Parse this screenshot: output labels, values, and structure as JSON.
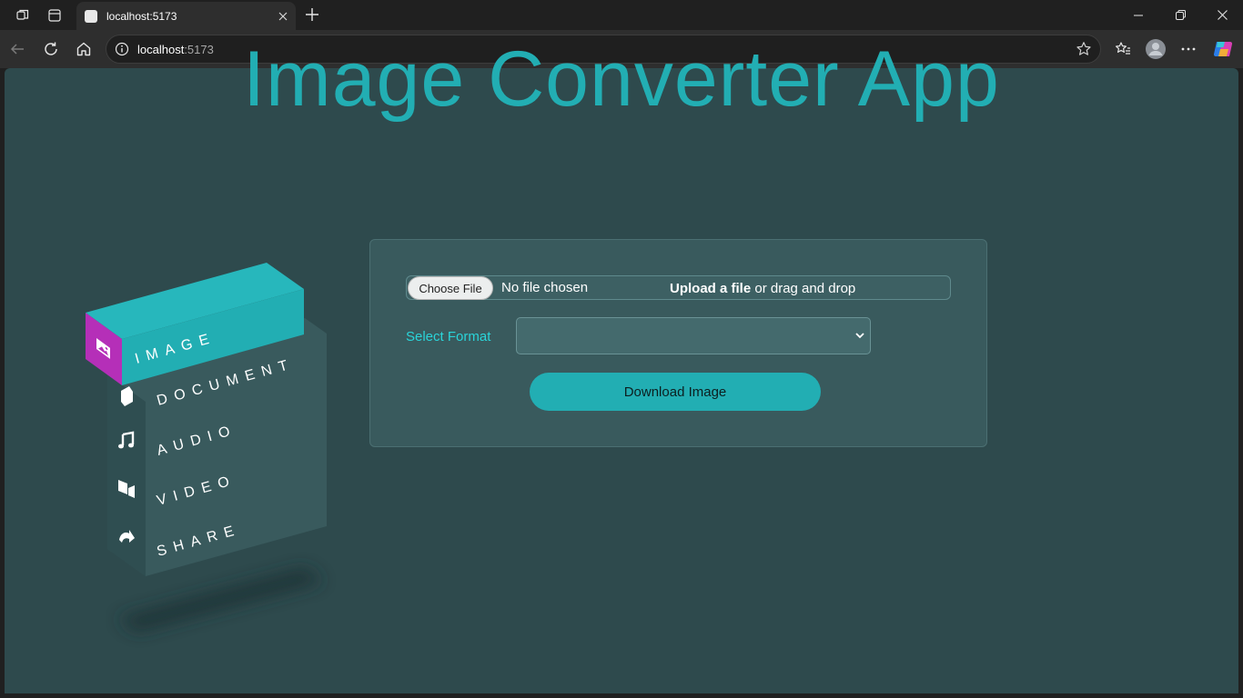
{
  "browser": {
    "tab_title": "localhost:5173",
    "url_host": "localhost",
    "url_port": ":5173"
  },
  "page": {
    "title": "Image Converter App"
  },
  "menu": {
    "items": [
      {
        "label": "IMAGE",
        "icon": "image-icon",
        "active": true
      },
      {
        "label": "DOCUMENT",
        "icon": "document-icon"
      },
      {
        "label": "AUDIO",
        "icon": "music-note-icon"
      },
      {
        "label": "VIDEO",
        "icon": "video-icon"
      },
      {
        "label": "SHARE",
        "icon": "share-icon"
      }
    ],
    "colors": {
      "top": "#22aeb3",
      "side": "#b52fb8",
      "body": "#395a5d"
    }
  },
  "converter": {
    "choose_file_label": "Choose File",
    "no_file_text": "No file chosen",
    "upload_bold": "Upload a file",
    "upload_rest": " or drag and drop",
    "format_label": "Select Format",
    "format_value": "",
    "download_label": "Download Image"
  },
  "colors": {
    "accent": "#22aeb3",
    "background": "#2e4a4d",
    "panel": "#395a5d",
    "label": "#2ad4d9"
  }
}
